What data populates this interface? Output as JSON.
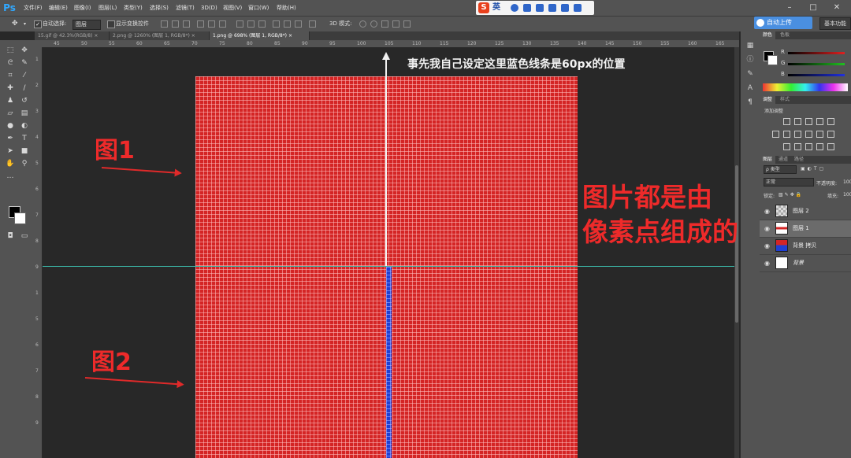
{
  "app": {
    "logo": "Ps"
  },
  "menu": [
    "文件(F)",
    "编辑(E)",
    "图像(I)",
    "图层(L)",
    "类型(Y)",
    "选择(S)",
    "滤镜(T)",
    "3D(D)",
    "视图(V)",
    "窗口(W)",
    "帮助(H)"
  ],
  "ime": {
    "brand": "S",
    "lang": "英"
  },
  "options_bar": {
    "auto_select_label": "自动选择:",
    "auto_select_value": "图层",
    "show_transform_label": "显示变换控件",
    "mode_3d_label": "3D 模式:",
    "cloud_button": "自动上传",
    "workspace_button": "基本功能"
  },
  "tabs": [
    {
      "label": "15.gif @ 42.3%(RGB/8)",
      "active": false
    },
    {
      "label": "2.png @ 1260% (图层 1, RGB/8*)",
      "active": false
    },
    {
      "label": "1.png @ 698% (图层 1, RGB/8*)",
      "active": true
    }
  ],
  "ruler_top": [
    "45",
    "50",
    "55",
    "60",
    "65",
    "70",
    "75",
    "80",
    "85",
    "90",
    "95",
    "100",
    "105",
    "110",
    "115",
    "120",
    "125",
    "130",
    "135",
    "140",
    "145",
    "150",
    "155",
    "160",
    "165"
  ],
  "ruler_top_center": [
    "60"
  ],
  "ruler_left": [
    "1",
    "2",
    "3",
    "4",
    "5",
    "6",
    "7",
    "8",
    "9",
    "1",
    "5",
    "6",
    "7",
    "8",
    "9"
  ],
  "annotations": {
    "top_note": "事先我自己设定这里蓝色线条是60px的位置",
    "label_1": "图1",
    "label_2": "图2",
    "big_line_1": "图片都是由",
    "big_line_2": "像素点组成的"
  },
  "color_panel": {
    "tabs": [
      "颜色",
      "色板"
    ],
    "channels": [
      {
        "label": "R",
        "color": "#e02020"
      },
      {
        "label": "G",
        "color": "#20c020"
      },
      {
        "label": "B",
        "color": "#2030e0"
      }
    ]
  },
  "adjust_panel": {
    "tabs": [
      "调整",
      "样式"
    ],
    "title": "添加调整"
  },
  "layers_panel": {
    "tabs": [
      "图层",
      "通道",
      "路径"
    ],
    "kind_filter": "ρ 类型",
    "blend_mode": "正常",
    "opacity_label": "不透明度:",
    "opacity_value": "100",
    "lock_label": "锁定:",
    "fill_label": "填充:",
    "fill_value": "100",
    "layers": [
      {
        "name": "图层 2",
        "thumb": "transparent",
        "active": false
      },
      {
        "name": "图层 1",
        "thumb": "red-strip",
        "active": true
      },
      {
        "name": "背景 拷贝",
        "thumb": "blue-red",
        "active": false
      },
      {
        "name": "背景",
        "thumb": "white",
        "active": false
      }
    ]
  },
  "colors": {
    "image_red": "#d42525",
    "pixel_column_blue": "#1f3fd4",
    "guide": "#3bb6a6",
    "annotation_red": "#ee2a2a"
  }
}
